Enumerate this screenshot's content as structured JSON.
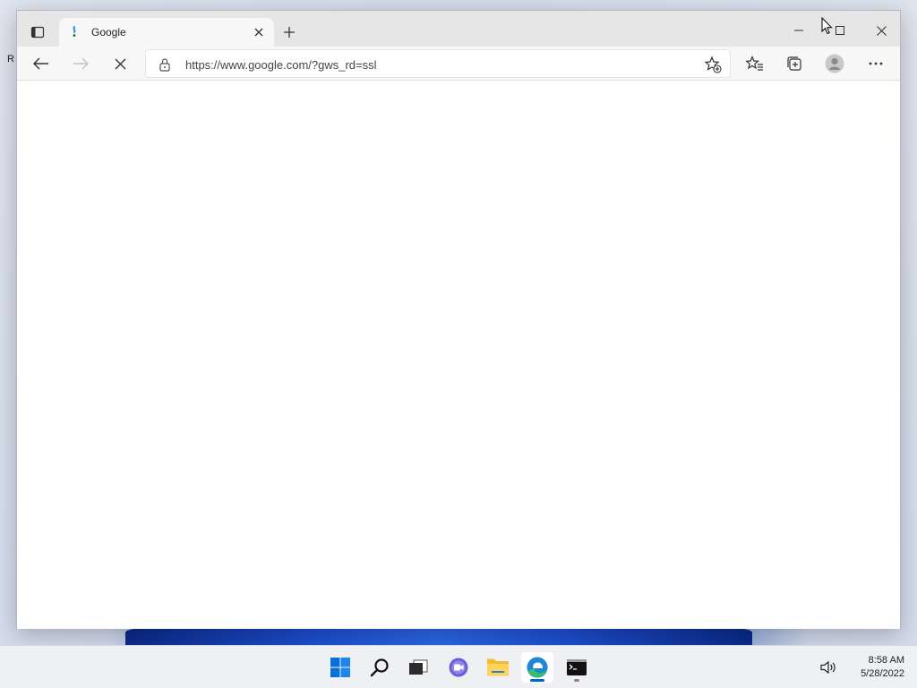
{
  "desktop": {
    "label": "R"
  },
  "browser": {
    "tab": {
      "title": "Google"
    },
    "address": {
      "url": "https://www.google.com/?gws_rd=ssl"
    },
    "icons": {
      "tab_actions": "tab-actions-icon",
      "favicon": "google-favicon-icon",
      "tab_close": "close-icon",
      "new_tab": "plus-icon",
      "back": "back-arrow-icon",
      "forward": "forward-arrow-icon",
      "stop": "stop-icon",
      "lock": "lock-icon",
      "add_favorite": "star-add-icon",
      "favorites": "favorites-icon",
      "collections": "collections-icon",
      "profile": "profile-icon",
      "more": "more-icon"
    }
  },
  "taskbar": {
    "apps": [
      "start",
      "search",
      "task-view",
      "chat",
      "file-explorer",
      "edge",
      "terminal"
    ],
    "clock": {
      "time": "8:58 AM",
      "date": "5/28/2022"
    }
  },
  "colors": {
    "accent": "#0067c0",
    "edge_blue": "#1e88d6",
    "edge_green": "#3bbf65"
  }
}
